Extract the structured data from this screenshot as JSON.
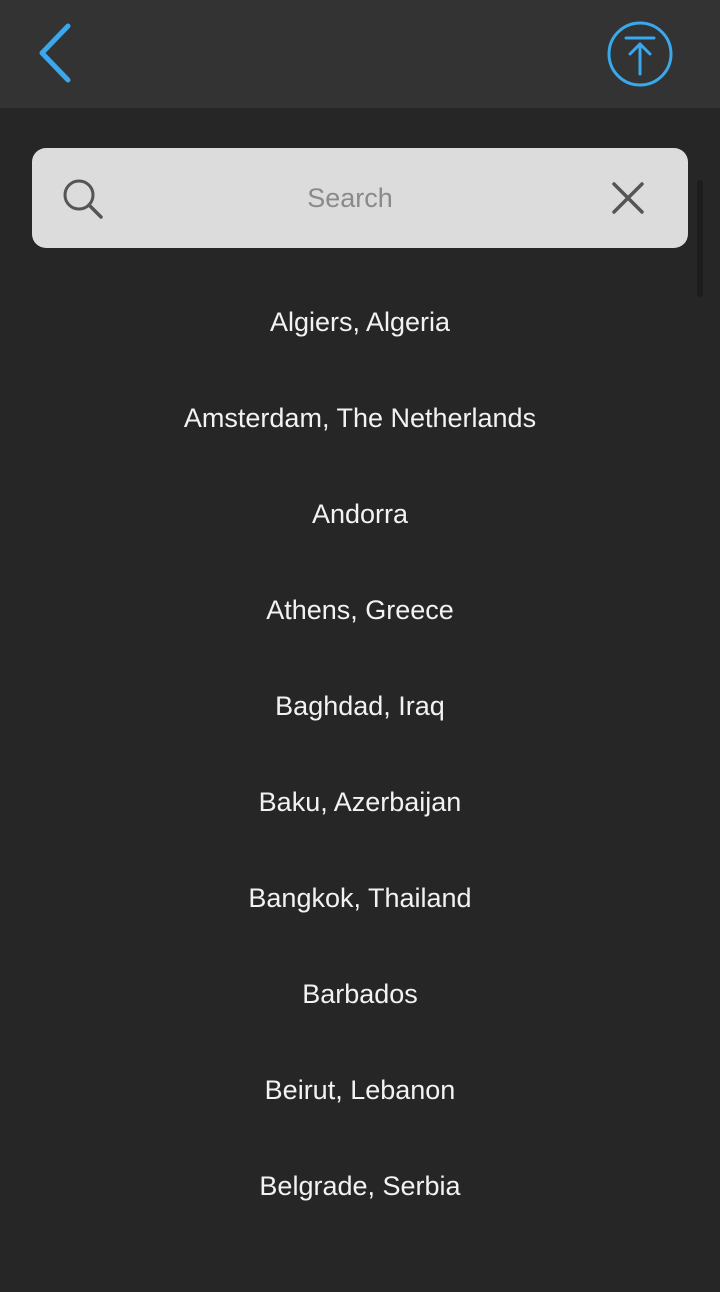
{
  "colors": {
    "accent": "#3aa8ec",
    "background": "#262626",
    "topbar": "#333333",
    "search_background": "#dcdcdc",
    "text": "#f2f2f2"
  },
  "header": {
    "back_icon": "chevron-left-icon",
    "scroll_top_icon": "arrow-up-circle-icon"
  },
  "search": {
    "placeholder": "Search",
    "value": "",
    "search_icon": "magnifier-icon",
    "clear_icon": "close-icon"
  },
  "cities": [
    "Algiers, Algeria",
    "Amsterdam, The Netherlands",
    "Andorra",
    "Athens, Greece",
    "Baghdad, Iraq",
    "Baku, Azerbaijan",
    "Bangkok, Thailand",
    "Barbados",
    "Beirut, Lebanon",
    "Belgrade, Serbia"
  ]
}
